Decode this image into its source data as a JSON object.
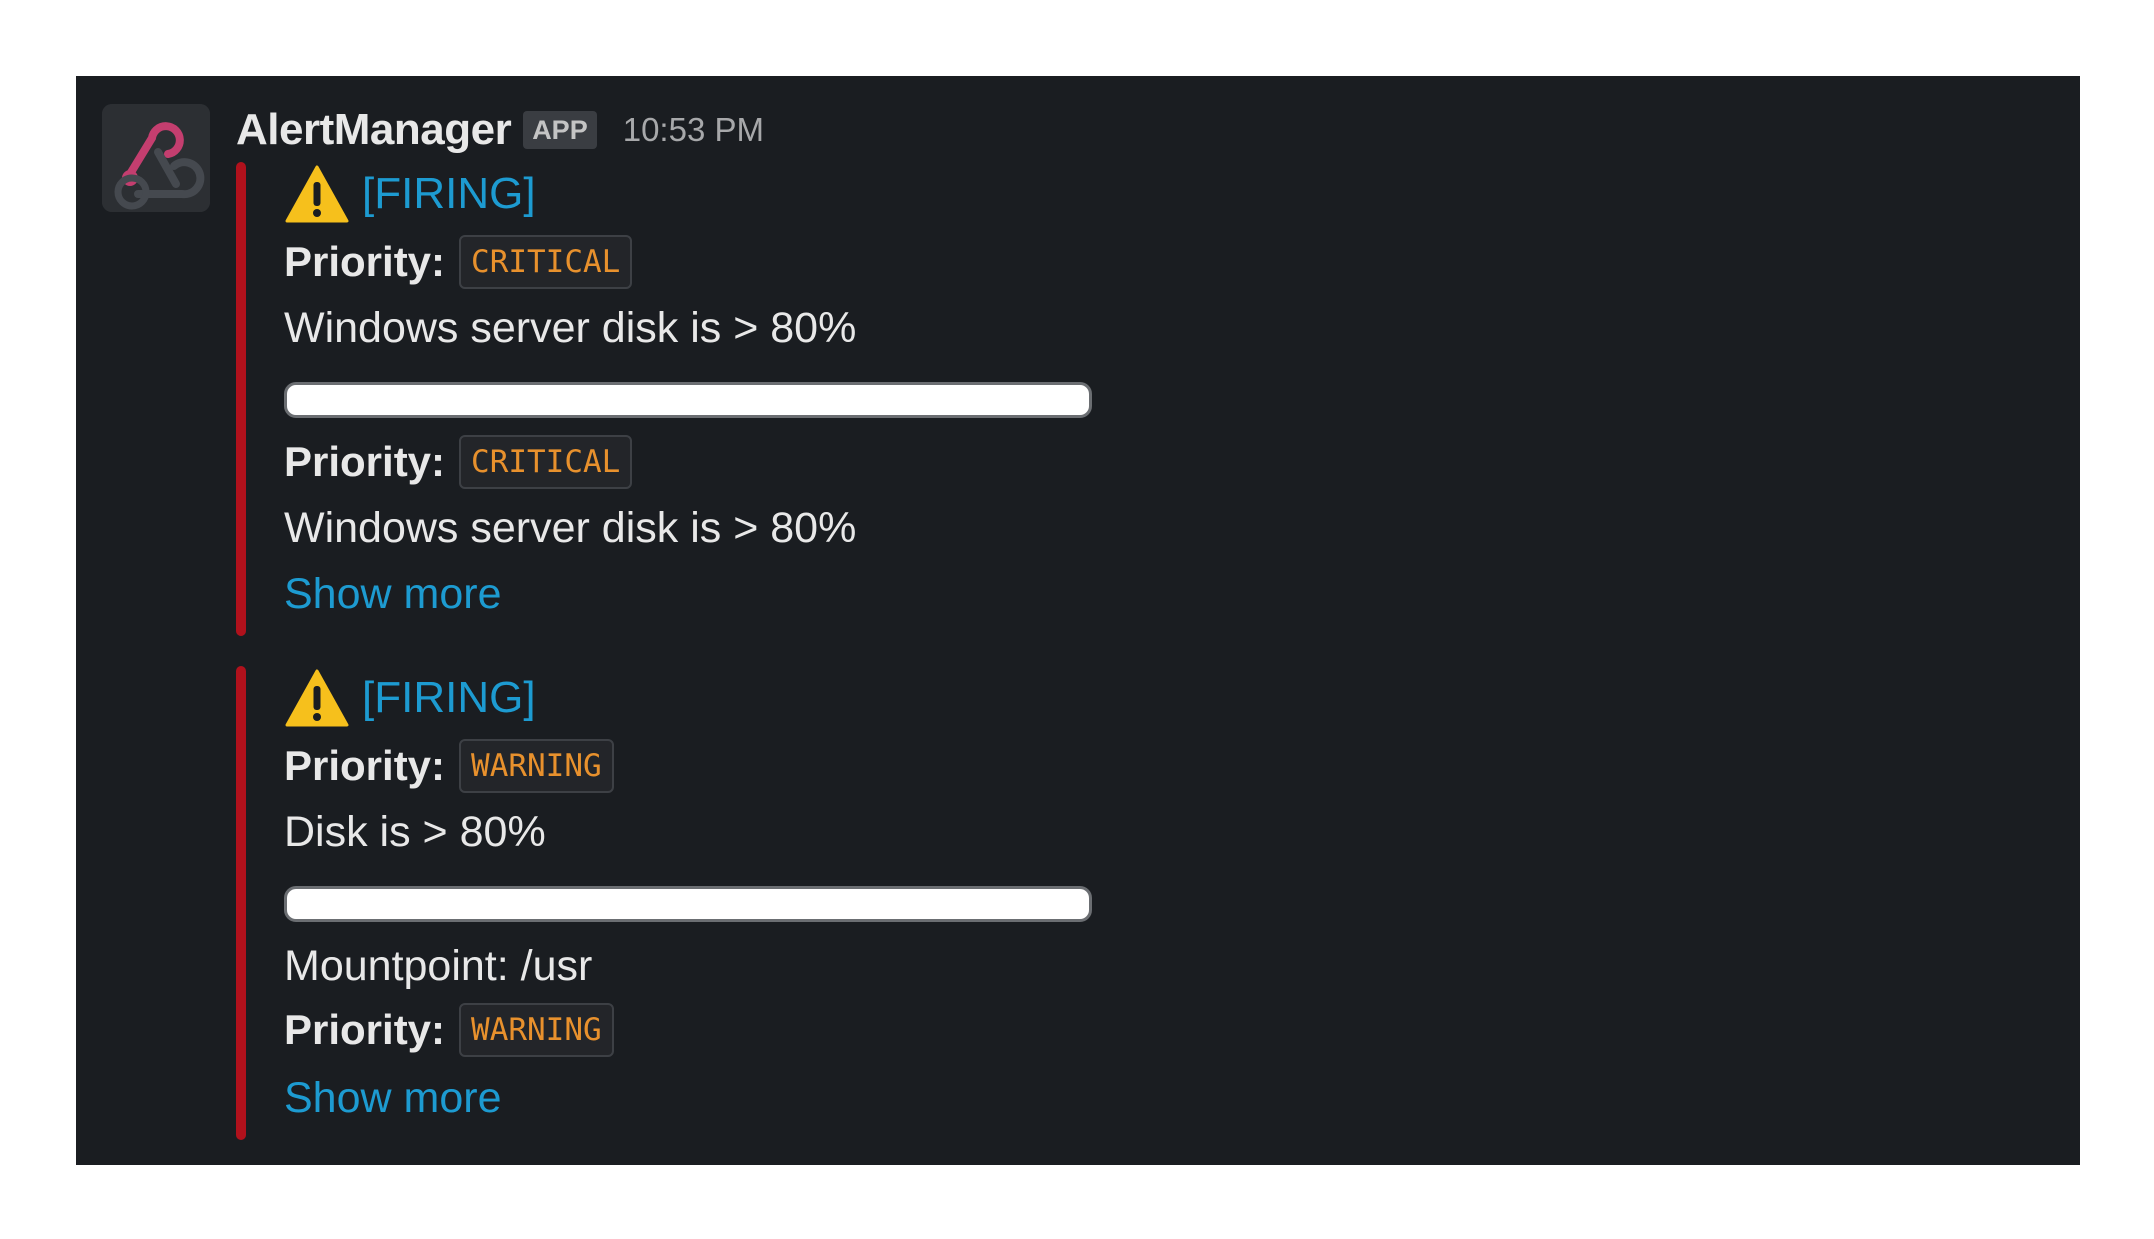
{
  "message": {
    "sender": "AlertManager",
    "badge": "APP",
    "time": "10:53 PM",
    "avatar_icon": "webhook-icon"
  },
  "colors": {
    "attachment_bar": "#b0111c",
    "link": "#1d9bd1",
    "code": "#e8912d",
    "background": "#1a1d21"
  },
  "alerts": [
    {
      "status": "[FIRING]",
      "icon": "warning-icon",
      "priority_label": "Priority:",
      "priority": "CRITICAL",
      "summary": "Windows server disk is > 80%",
      "priority_label_2": "Priority:",
      "priority_2": "CRITICAL",
      "summary_2": "Windows server disk is > 80%",
      "show_more": "Show more"
    },
    {
      "status": "[FIRING]",
      "icon": "warning-icon",
      "priority_label": "Priority:",
      "priority": "WARNING",
      "summary": "Disk is > 80%",
      "mountpoint": "Mountpoint: /usr",
      "priority_label_2": "Priority:",
      "priority_2": "WARNING",
      "show_more": "Show more"
    }
  ]
}
